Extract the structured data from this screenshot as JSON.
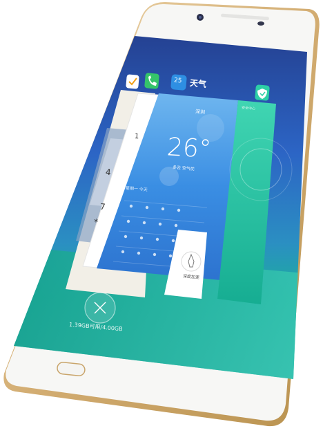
{
  "weather_app": {
    "title": "天气",
    "icon_number": "25",
    "location": "深圳",
    "temperature": "26°",
    "condition": "多云 空气优",
    "forecast_header": "星期一 今天"
  },
  "phone_app": {
    "numbers": [
      "1",
      "4",
      "7",
      "*"
    ]
  },
  "security_app": {
    "label": "安全中心"
  },
  "clean_app": {
    "button_label": "深度加速"
  },
  "memory": {
    "usage": "1.39GB可用/4.00GB"
  },
  "colors": {
    "gold_frame": "#d6b27a",
    "screen_blue": "#2b67c7",
    "teal_bottom": "#1fb39a",
    "weather_blue": "#3b8fe0",
    "security_green": "#24c7a3"
  }
}
